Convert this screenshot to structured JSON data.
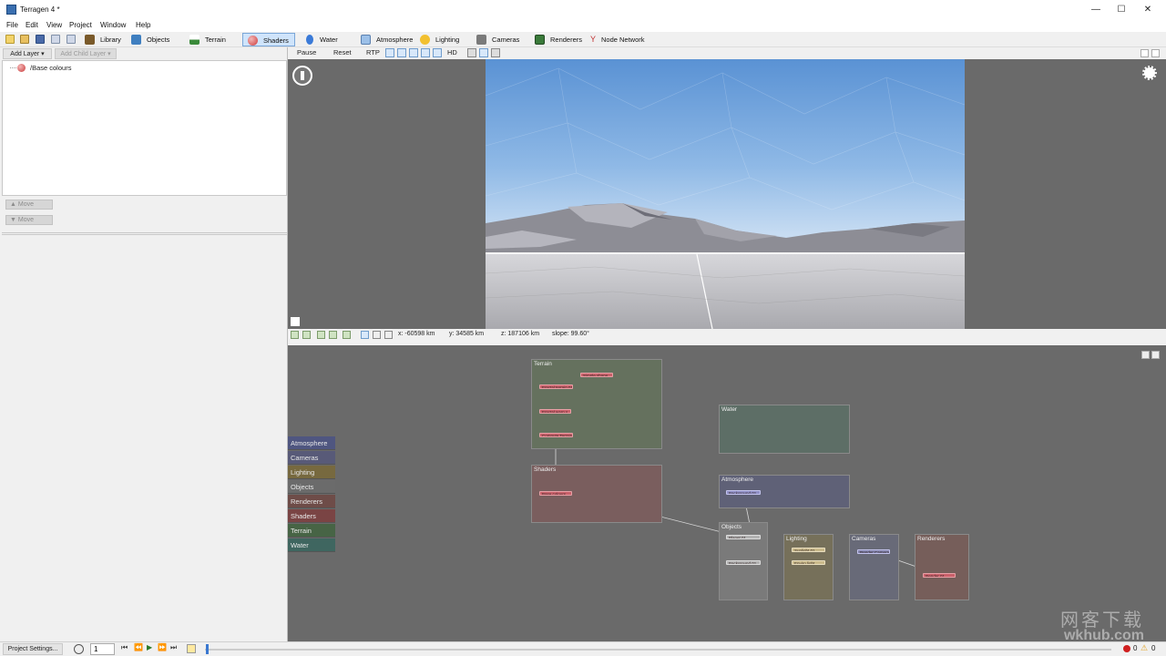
{
  "window": {
    "title": "Terragen 4 *",
    "minimize": "—",
    "maximize": "☐",
    "close": "✕"
  },
  "menu": [
    "File",
    "Edit",
    "View",
    "Project",
    "Window",
    "Help"
  ],
  "toolbar": {
    "modes": [
      {
        "label": "Library",
        "icon": "library-icon",
        "color": "#7a5a2a"
      },
      {
        "label": "Objects",
        "icon": "cube-icon",
        "color": "#3f7fc0"
      },
      {
        "label": "Terrain",
        "icon": "mountain-icon",
        "color": "#3a8a3a"
      },
      {
        "label": "Shaders",
        "icon": "sphere-icon",
        "color": "#cc3a3a"
      },
      {
        "label": "Water",
        "icon": "drop-icon",
        "color": "#3a7ad8"
      },
      {
        "label": "Atmosphere",
        "icon": "cloud-icon",
        "color": "#6aa0d8"
      },
      {
        "label": "Lighting",
        "icon": "sun-icon",
        "color": "#e8b020"
      },
      {
        "label": "Cameras",
        "icon": "camera-icon",
        "color": "#6a6a6a"
      },
      {
        "label": "Renderers",
        "icon": "renderer-icon",
        "color": "#3a7a3a"
      },
      {
        "label": "Node Network",
        "icon": "network-icon",
        "color": "#c03030"
      }
    ],
    "active_mode": "Shaders"
  },
  "left_panel": {
    "add_layer": "Add Layer",
    "add_child_layer": "Add Child Layer",
    "layers": [
      {
        "label": "/Base colours"
      }
    ],
    "move_up": "Move",
    "move_down": "Move"
  },
  "render_controls": {
    "pause": "Pause",
    "reset": "Reset",
    "rtp": "RTP",
    "hd": "HD"
  },
  "coords": {
    "x": "x: -60598 km",
    "y": "y: 34585 km",
    "z": "z: 187106 km",
    "slope": "slope: 99.60°"
  },
  "node_network": {
    "categories": [
      {
        "label": "Atmosphere",
        "color": "#4f5680"
      },
      {
        "label": "Cameras",
        "color": "#585a78"
      },
      {
        "label": "Lighting",
        "color": "#77693f"
      },
      {
        "label": "Objects",
        "color": "#6b6b6b"
      },
      {
        "label": "Renderers",
        "color": "#6e4c48"
      },
      {
        "label": "Shaders",
        "color": "#7a4444"
      },
      {
        "label": "Terrain",
        "color": "#476445"
      },
      {
        "label": "Water",
        "color": "#3f6660"
      }
    ],
    "groups": {
      "terrain": "Terrain",
      "shaders": "Shaders",
      "water": "Water",
      "atmosphere": "Atmosphere",
      "objects": "Objects",
      "lighting": "Lighting",
      "cameras": "Cameras",
      "renderers": "Renderers"
    },
    "nodes": {
      "simple_shape": "Simple shape",
      "fractal_terrain": "Fractal terrain 01",
      "fractal_warp": "Fractal warp s",
      "compute_terrain": "Compute Terrain",
      "base_colours": "Base colours",
      "background": "Background 01",
      "planet": "Planet 01",
      "background_obj": "Background 01",
      "sunlight": "Sunlight 01",
      "enviro_light": "Enviro light",
      "render_camera": "Render Camera",
      "render": "Render 01"
    }
  },
  "bottom": {
    "project_settings": "Project Settings...",
    "frame": "1",
    "error_count": "0",
    "warning_count": "0"
  },
  "watermark": {
    "line1": "网客下载",
    "line2": "wkhub.com"
  }
}
